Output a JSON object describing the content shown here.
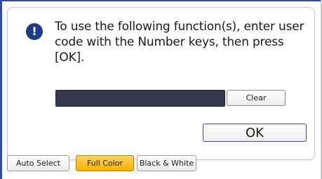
{
  "dialog": {
    "message_line1": "To use the following function(s), enter user",
    "message_line2": "code with the Number keys, then press [OK].",
    "alert_icon_glyph": "!",
    "icon": "exclamation-icon",
    "code_value": ""
  },
  "buttons": {
    "clear_label": "Clear",
    "ok_label": "OK"
  },
  "color_modes": {
    "items": [
      {
        "label": "Auto Select",
        "selected": false
      },
      {
        "label": "Full Color",
        "selected": true
      },
      {
        "label": "Black & White",
        "selected": false
      }
    ]
  },
  "colors": {
    "accent": "#1e3c88",
    "selected_mode": "#f5b400",
    "input_field": "#353a4d"
  }
}
